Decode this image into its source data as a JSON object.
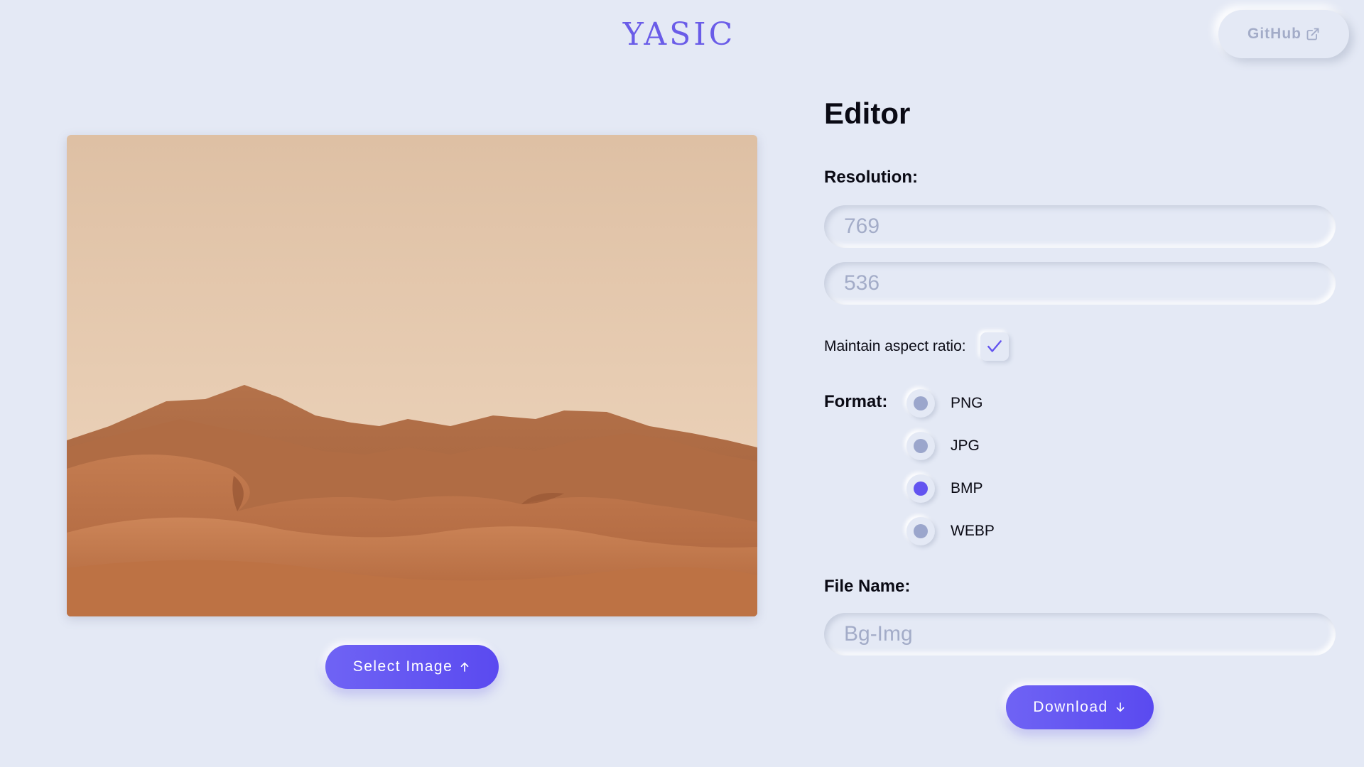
{
  "header": {
    "logo": "YASIC",
    "github_label": "GitHub"
  },
  "preview": {
    "select_button_label": "Select Image"
  },
  "editor": {
    "title": "Editor",
    "resolution_label": "Resolution:",
    "width_placeholder": "769",
    "height_placeholder": "536",
    "aspect_label": "Maintain aspect ratio:",
    "aspect_checked": true,
    "format_label": "Format:",
    "formats": [
      {
        "label": "PNG",
        "selected": false
      },
      {
        "label": "JPG",
        "selected": false
      },
      {
        "label": "BMP",
        "selected": true
      },
      {
        "label": "WEBP",
        "selected": false
      }
    ],
    "filename_label": "File Name:",
    "filename_placeholder": "Bg-Img",
    "download_label": "Download"
  },
  "colors": {
    "background": "#e4e9f5",
    "accent": "#6354f0",
    "muted": "#a3acc8"
  }
}
